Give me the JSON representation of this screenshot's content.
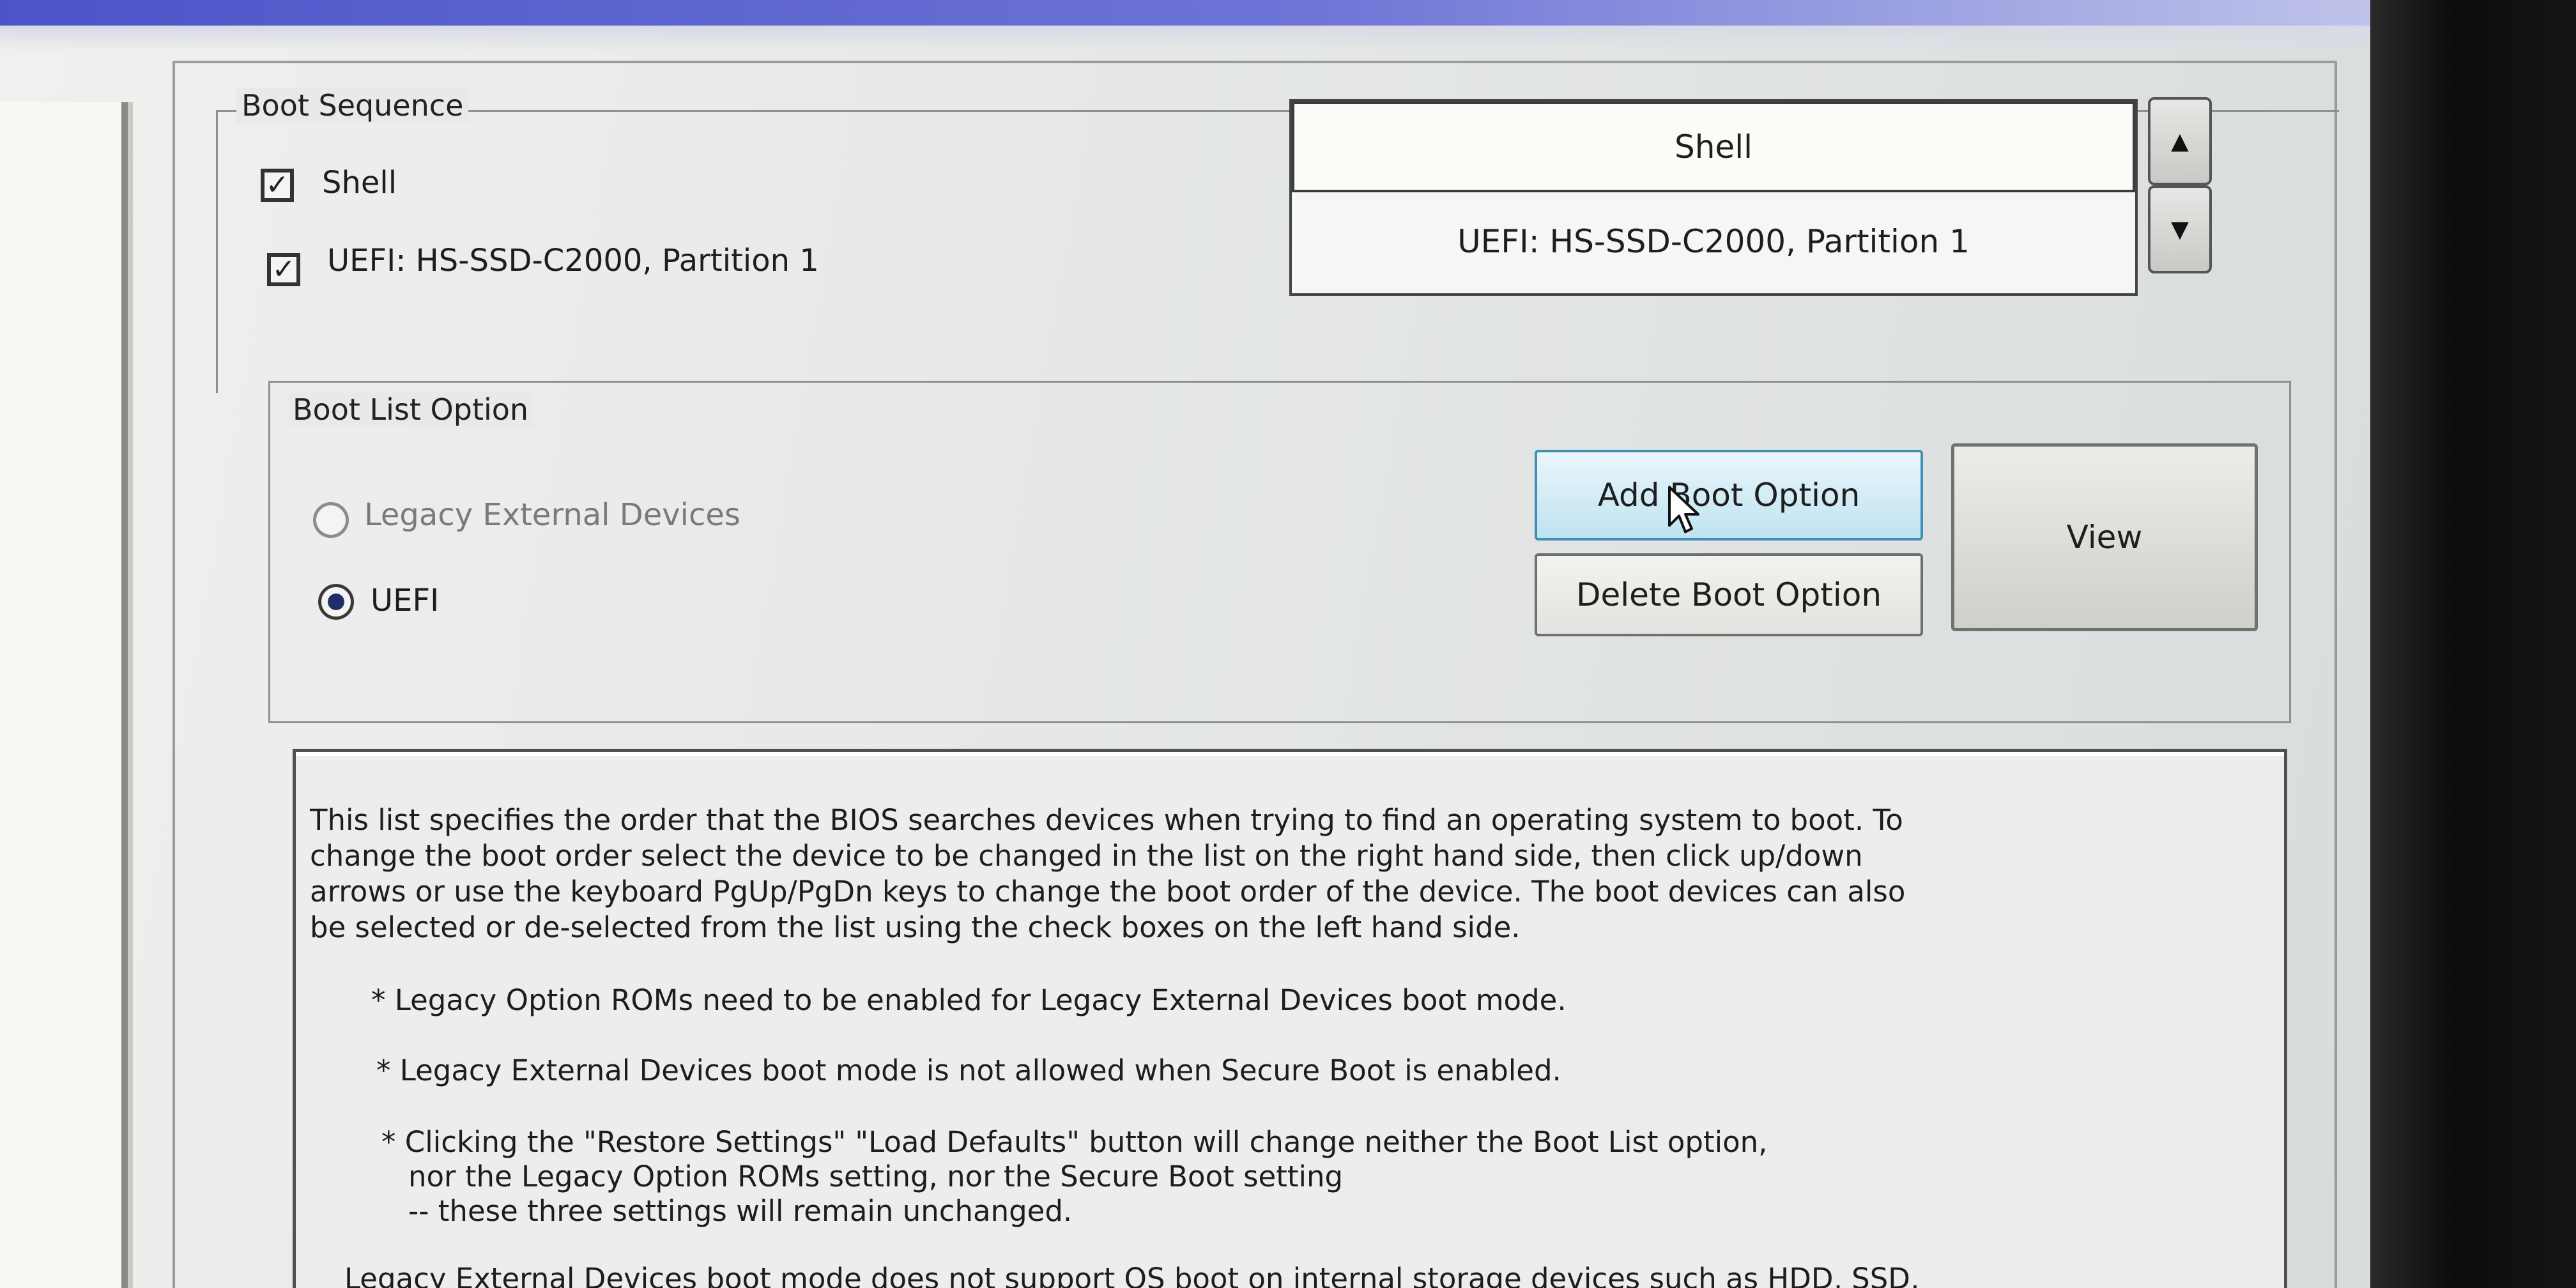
{
  "boot_sequence": {
    "legend": "Boot Sequence",
    "items": [
      {
        "label": "Shell",
        "checked": true
      },
      {
        "label": "UEFI: HS-SSD-C2000, Partition 1",
        "checked": true
      }
    ],
    "list": [
      "Shell",
      "UEFI: HS-SSD-C2000, Partition 1"
    ],
    "move_up_icon": "triangle-up",
    "move_down_icon": "triangle-down"
  },
  "boot_list_option": {
    "legend": "Boot List Option",
    "options": [
      {
        "label": "Legacy External Devices",
        "selected": false,
        "enabled": false
      },
      {
        "label": "UEFI",
        "selected": true,
        "enabled": true
      }
    ],
    "buttons": {
      "add": "Add Boot Option",
      "delete": "Delete Boot Option",
      "view": "View"
    }
  },
  "description": {
    "paragraph": [
      "This list specifies the order that the BIOS searches devices when trying to find an operating system to boot. To",
      "change the boot order select the device to be changed in the list on the right hand side, then click up/down",
      "arrows or use the keyboard PgUp/PgDn keys to change the boot order of the device. The boot devices can also",
      "be selected or de-selected from the list using the check boxes on the left hand side."
    ],
    "notes": [
      "* Legacy Option ROMs need to be enabled for Legacy External Devices boot mode.",
      "* Legacy External Devices boot mode is not allowed when Secure Boot is enabled."
    ],
    "restore_note": [
      "* Clicking the \"Restore Settings\" \"Load Defaults\" button will change neither the Boot List option,",
      "nor the Legacy Option ROMs setting, nor the Secure Boot setting",
      "-- these three settings will remain unchanged."
    ],
    "trailing": "Legacy External Devices boot mode does not support OS boot on internal storage devices such as HDD, SSD,"
  },
  "colors": {
    "hover_button": "#bfe3f1",
    "radio_selected": "#1f2e6a",
    "title_bar": "#4b55c8"
  }
}
